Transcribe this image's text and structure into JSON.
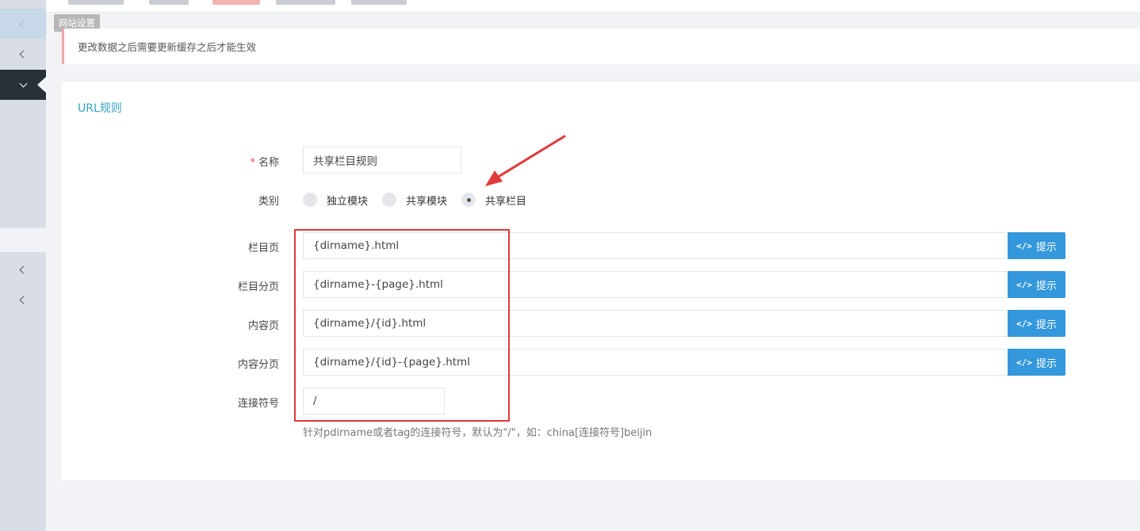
{
  "sidebar": {
    "tooltip": "网站设置",
    "items": [
      {
        "icon": "chevron-left-icon",
        "state": "hover"
      },
      {
        "icon": "chevron-left-icon",
        "state": "normal"
      },
      {
        "icon": "chevron-down-icon",
        "state": "active"
      },
      {
        "icon": "chevron-left-icon",
        "state": "normal"
      },
      {
        "icon": "chevron-left-icon",
        "state": "normal"
      }
    ]
  },
  "alert": {
    "text": "更改数据之后需要更新缓存之后才能生效"
  },
  "panel": {
    "title": "URL规则",
    "name": {
      "required_mark": "*",
      "label": "名称",
      "value": "共享栏目规则"
    },
    "category": {
      "label": "类别",
      "options": [
        {
          "label": "独立模块",
          "checked": false
        },
        {
          "label": "共享模块",
          "checked": false
        },
        {
          "label": "共享栏目",
          "checked": true
        }
      ]
    },
    "fields": [
      {
        "label": "栏目页",
        "value": "{dirname}.html",
        "hint": "提示"
      },
      {
        "label": "栏目分页",
        "value": "{dirname}-{page}.html",
        "hint": "提示"
      },
      {
        "label": "内容页",
        "value": "{dirname}/{id}.html",
        "hint": "提示"
      },
      {
        "label": "内容分页",
        "value": "{dirname}/{id}-{page}.html",
        "hint": "提示"
      }
    ],
    "connector": {
      "label": "连接符号",
      "value": "/",
      "help": "针对pdirname或者tag的连接符号，默认为\"/\"，如：china[连接符号]beijin"
    }
  },
  "colors": {
    "accent": "#3598dc",
    "title": "#36a3c4",
    "sidebar_active": "#283038",
    "annotation": "#e03a3a",
    "alert_border": "#f0a6a6"
  }
}
